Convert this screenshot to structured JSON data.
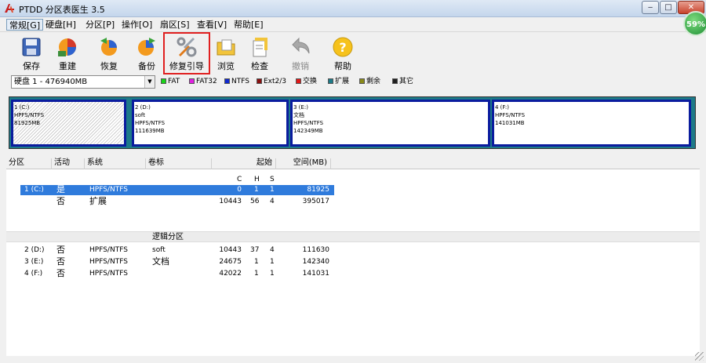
{
  "window": {
    "title": "PTDD 分区表医生 3.5"
  },
  "menu": [
    "常规[G]",
    "硬盘[H]",
    "分区[P]",
    "操作[O]",
    "扇区[S]",
    "查看[V]",
    "帮助[E]"
  ],
  "toolbar": {
    "items": [
      {
        "label": "保存",
        "icon": "save-icon"
      },
      {
        "label": "重建",
        "icon": "rebuild-icon"
      },
      {
        "label": "恢复",
        "icon": "restore-icon"
      },
      {
        "label": "备份",
        "icon": "backup-icon"
      },
      {
        "label": "修复引导",
        "icon": "repair-boot-icon"
      },
      {
        "label": "浏览",
        "icon": "browse-icon"
      },
      {
        "label": "检查",
        "icon": "check-icon"
      },
      {
        "label": "撤销",
        "icon": "undo-icon"
      },
      {
        "label": "帮助",
        "icon": "help-icon"
      }
    ]
  },
  "badge": "59%",
  "disk_selector": {
    "value": "硬盘 1 - 476940MB"
  },
  "legend": [
    {
      "label": "FAT",
      "color": "#18d418"
    },
    {
      "label": "FAT32",
      "color": "#e020e0"
    },
    {
      "label": "NTFS",
      "color": "#1028d0"
    },
    {
      "label": "Ext2/3",
      "color": "#8a1010"
    },
    {
      "label": "交换",
      "color": "#e01818"
    },
    {
      "label": "扩展",
      "color": "#1d7a88"
    },
    {
      "label": "剩余",
      "color": "#8a8a18"
    },
    {
      "label": "其它",
      "color": "#202020"
    }
  ],
  "partitions": [
    {
      "l1": "1 (C:)",
      "l2": "",
      "l3": "HPFS/NTFS",
      "l4": "81925MB"
    },
    {
      "l1": "2 (D:)",
      "l2": "soft",
      "l3": "HPFS/NTFS",
      "l4": "111639MB"
    },
    {
      "l1": "3 (E:)",
      "l2": "文档",
      "l3": "HPFS/NTFS",
      "l4": "142349MB"
    },
    {
      "l1": "4 (F:)",
      "l2": "",
      "l3": "HPFS/NTFS",
      "l4": "141031MB"
    }
  ],
  "table": {
    "headers": [
      "分区",
      "活动",
      "系统",
      "卷标",
      "起始",
      "空间(MB)"
    ],
    "chs": [
      "C",
      "H",
      "S"
    ],
    "primary_rows": [
      {
        "part": "1 (C:)",
        "active": "是",
        "system": "HPFS/NTFS",
        "label": "",
        "c": "0",
        "h": "1",
        "s": "1",
        "size": "81925"
      },
      {
        "part": "",
        "active": "否",
        "system": "扩展",
        "label": "",
        "c": "10443",
        "h": "56",
        "s": "4",
        "size": "395017"
      }
    ],
    "group_label": "逻辑分区",
    "logical_rows": [
      {
        "part": "2 (D:)",
        "active": "否",
        "system": "HPFS/NTFS",
        "label": "soft",
        "c": "10443",
        "h": "37",
        "s": "4",
        "size": "111630"
      },
      {
        "part": "3 (E:)",
        "active": "否",
        "system": "HPFS/NTFS",
        "label": "文档",
        "c": "24675",
        "h": "1",
        "s": "1",
        "size": "142340"
      },
      {
        "part": "4 (F:)",
        "active": "否",
        "system": "HPFS/NTFS",
        "label": "",
        "c": "42022",
        "h": "1",
        "s": "1",
        "size": "141031"
      }
    ]
  }
}
